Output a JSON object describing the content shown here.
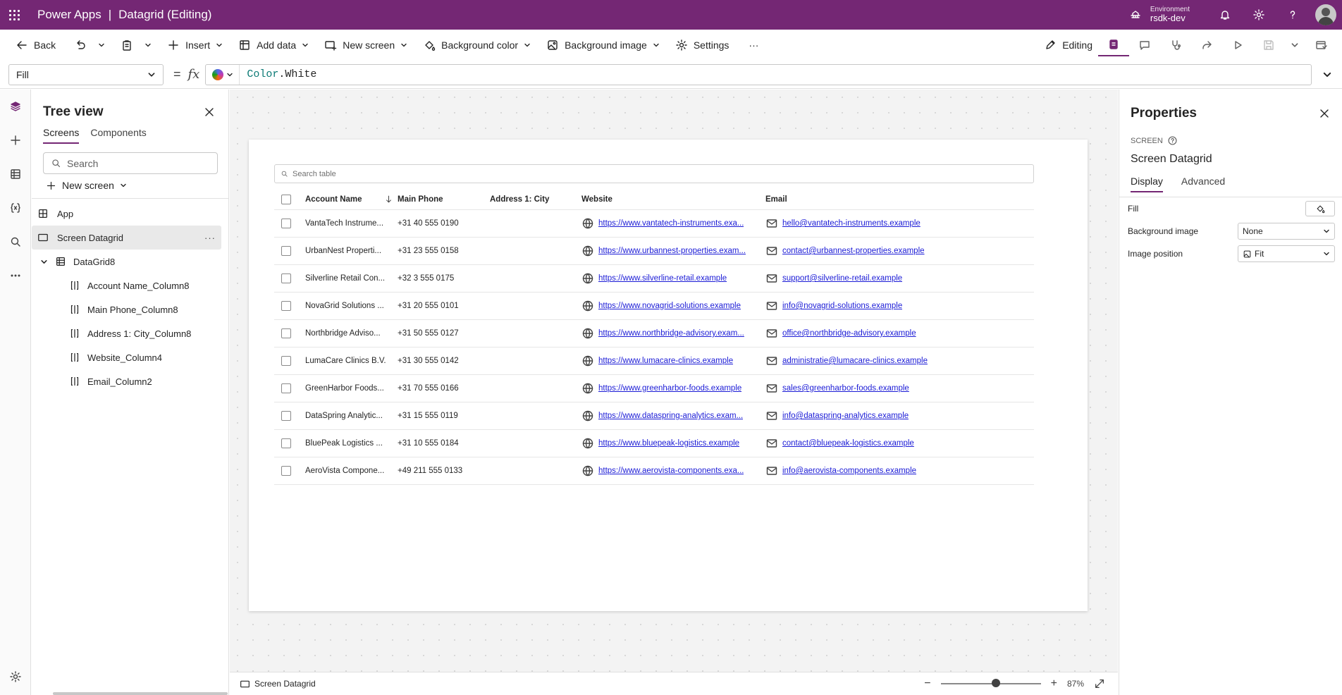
{
  "app": {
    "name": "Power Apps",
    "separator": "|",
    "document": "Datagrid (Editing)",
    "environment_label": "Environment",
    "environment_name": "rsdk-dev"
  },
  "commands": {
    "back": "Back",
    "insert": "Insert",
    "add_data": "Add data",
    "new_screen": "New screen",
    "background_color": "Background color",
    "background_image": "Background image",
    "settings": "Settings",
    "more": "···",
    "editing": "Editing"
  },
  "formula": {
    "property": "Fill",
    "equals": "=",
    "fx": "fx",
    "object": "Color",
    "member": ".White"
  },
  "tree": {
    "title": "Tree view",
    "tabs": [
      "Screens",
      "Components"
    ],
    "search_placeholder": "Search",
    "new_screen": "New screen",
    "app": "App",
    "screen": "Screen Datagrid",
    "datagrid": "DataGrid8",
    "columns": [
      "Account Name_Column8",
      "Main Phone_Column8",
      "Address 1: City_Column8",
      "Website_Column4",
      "Email_Column2"
    ],
    "more": "···"
  },
  "grid": {
    "search_placeholder": "Search table",
    "headers": {
      "name": "Account Name",
      "phone": "Main Phone",
      "city": "Address 1: City",
      "website": "Website",
      "email": "Email"
    },
    "rows": [
      {
        "name": "VantaTech Instrume...",
        "phone": "+31 40 555 0190",
        "city": "",
        "website": "https://www.vantatech-instruments.exa...",
        "email": "hello@vantatech-instruments.example"
      },
      {
        "name": "UrbanNest Properti...",
        "phone": "+31 23 555 0158",
        "city": "",
        "website": "https://www.urbannest-properties.exam...",
        "email": "contact@urbannest-properties.example"
      },
      {
        "name": "Silverline Retail Con...",
        "phone": "+32 3 555 0175",
        "city": "",
        "website": "https://www.silverline-retail.example",
        "email": "support@silverline-retail.example"
      },
      {
        "name": "NovaGrid Solutions ...",
        "phone": "+31 20 555 0101",
        "city": "",
        "website": "https://www.novagrid-solutions.example",
        "email": "info@novagrid-solutions.example"
      },
      {
        "name": "Northbridge Adviso...",
        "phone": "+31 50 555 0127",
        "city": "",
        "website": "https://www.northbridge-advisory.exam...",
        "email": "office@northbridge-advisory.example"
      },
      {
        "name": "LumaCare Clinics B.V.",
        "phone": "+31 30 555 0142",
        "city": "",
        "website": "https://www.lumacare-clinics.example",
        "email": "administratie@lumacare-clinics.example"
      },
      {
        "name": "GreenHarbor Foods...",
        "phone": "+31 70 555 0166",
        "city": "",
        "website": "https://www.greenharbor-foods.example",
        "email": "sales@greenharbor-foods.example"
      },
      {
        "name": "DataSpring Analytic...",
        "phone": "+31 15 555 0119",
        "city": "",
        "website": "https://www.dataspring-analytics.exam...",
        "email": "info@dataspring-analytics.example"
      },
      {
        "name": "BluePeak Logistics ...",
        "phone": "+31 10 555 0184",
        "city": "",
        "website": "https://www.bluepeak-logistics.example",
        "email": "contact@bluepeak-logistics.example"
      },
      {
        "name": "AeroVista Compone...",
        "phone": "+49 211 555 0133",
        "city": "",
        "website": "https://www.aerovista-components.exa...",
        "email": "info@aerovista-components.example"
      }
    ]
  },
  "statusbar": {
    "screen": "Screen Datagrid",
    "zoom_minus": "−",
    "zoom_plus": "+",
    "zoom": "87%",
    "zoom_fraction": 0.55
  },
  "properties": {
    "title": "Properties",
    "type": "SCREEN",
    "name": "Screen Datagrid",
    "tabs": [
      "Display",
      "Advanced"
    ],
    "fill_label": "Fill",
    "bg_image_label": "Background image",
    "bg_image_value": "None",
    "image_position_label": "Image position",
    "image_position_value": "Fit"
  },
  "colors": {
    "brand": "#742774",
    "link": "#1b1bd6"
  }
}
